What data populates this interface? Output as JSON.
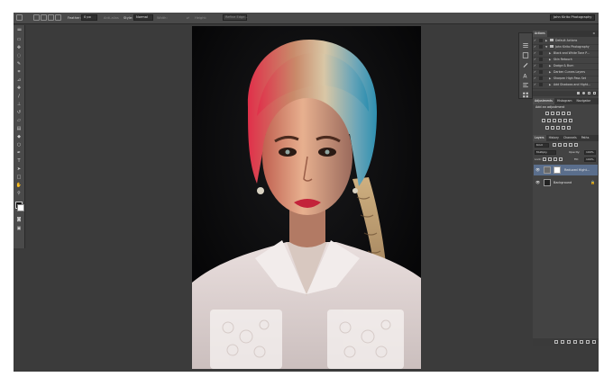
{
  "options_bar": {
    "feather_label": "Feather:",
    "feather_value": "0 px",
    "antialias_label": "Anti-alias",
    "style_label": "Style:",
    "style_value": "Normal",
    "width_label": "Width:",
    "height_label": "Height:",
    "refine_edge_label": "Refine Edge...",
    "workspace": "John Kirito Photography"
  },
  "tools": [
    "marquee-icon",
    "move-icon",
    "lasso-icon",
    "quick-select-icon",
    "crop-icon",
    "eyedropper-icon",
    "healing-icon",
    "brush-icon",
    "clone-stamp-icon",
    "history-brush-icon",
    "eraser-icon",
    "gradient-icon",
    "blur-icon",
    "dodge-icon",
    "pen-icon",
    "type-icon",
    "path-select-icon",
    "shape-icon",
    "hand-icon",
    "zoom-icon"
  ],
  "actions_panel": {
    "tab": "Actions",
    "items": [
      {
        "label": "Default Actions",
        "checked": true,
        "indent": 0,
        "open": false
      },
      {
        "label": "John Kirito Photography",
        "checked": true,
        "indent": 0,
        "open": true
      },
      {
        "label": "Black and White Tone P...",
        "checked": true,
        "indent": 1,
        "open": false
      },
      {
        "label": "Skin Retouch",
        "checked": true,
        "indent": 1,
        "open": false
      },
      {
        "label": "Dodge & Burn",
        "checked": true,
        "indent": 1,
        "open": false
      },
      {
        "label": "Darken Curves Layers",
        "checked": true,
        "indent": 1,
        "open": false
      },
      {
        "label": "Sharpen High Pass Set",
        "checked": true,
        "indent": 1,
        "open": false
      },
      {
        "label": "Add Shadows and Hight...",
        "checked": true,
        "indent": 1,
        "open": false
      }
    ]
  },
  "adjustments_panel": {
    "tabs": [
      "Adjustments",
      "Histogram",
      "Navigator"
    ],
    "add_label": "Add an adjustment"
  },
  "layers_panel": {
    "tabs": [
      "Layers",
      "History",
      "Channels",
      "Paths"
    ],
    "kind_label": "Kind",
    "blend_mode": "Multiply",
    "opacity_label": "Opacity:",
    "opacity_value": "100%",
    "lock_label": "Lock:",
    "fill_label": "Fill:",
    "fill_value": "100%",
    "layers": [
      {
        "name": "Reduced Hight...",
        "selected": true
      },
      {
        "name": "Background",
        "selected": false
      }
    ]
  },
  "colors": {
    "app_bg": "#3b3b3b",
    "panel_bg": "#434343",
    "selected_layer": "#5a6e8c",
    "text": "#d6d6d6"
  }
}
